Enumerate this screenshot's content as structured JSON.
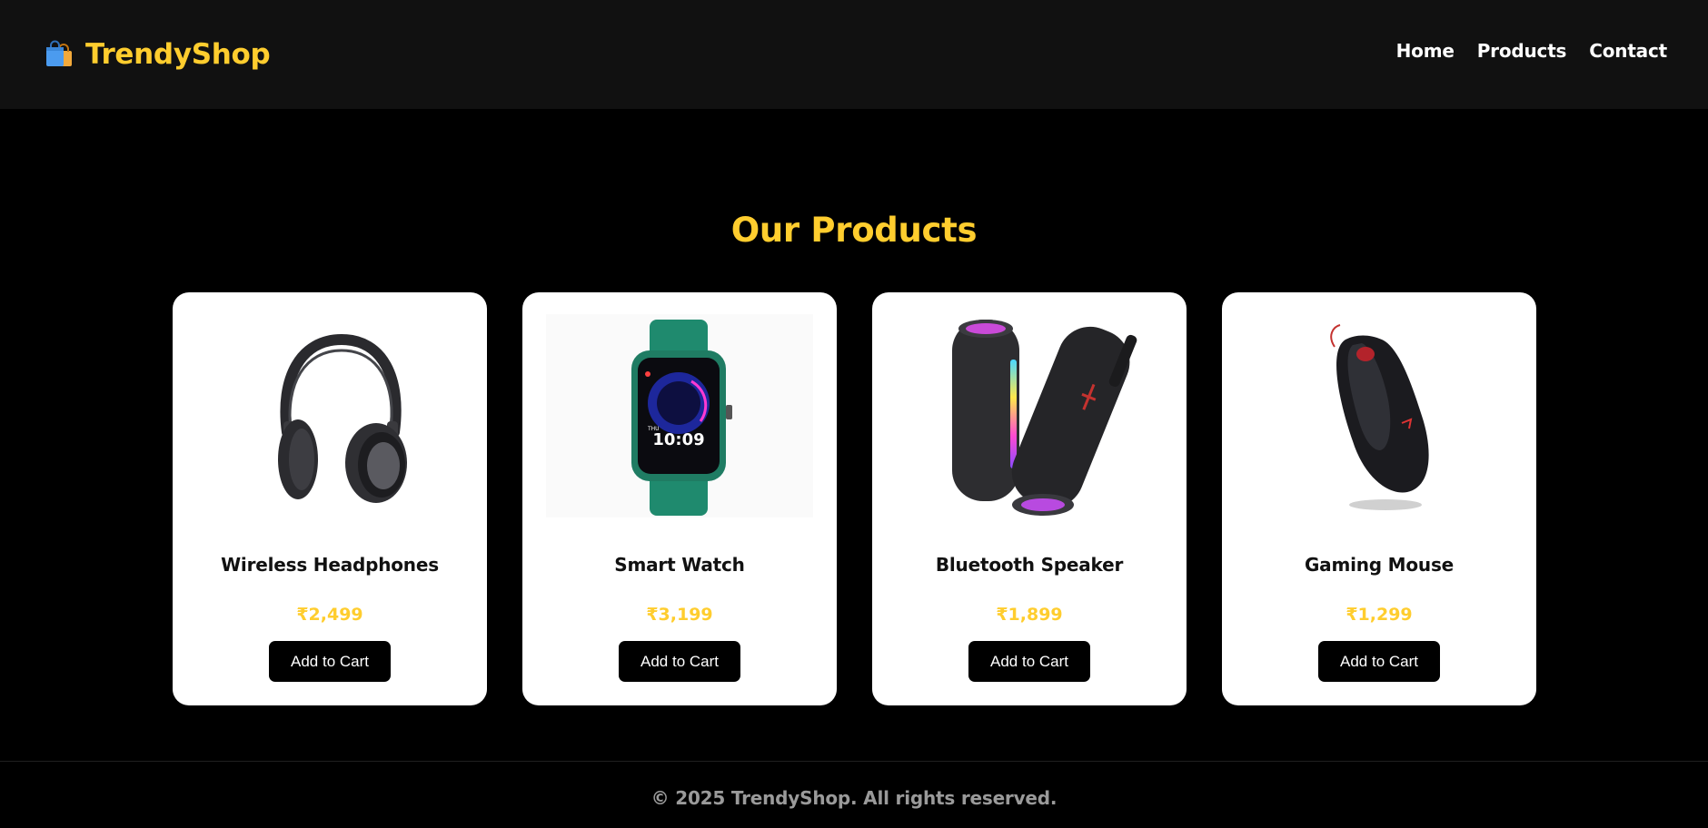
{
  "header": {
    "brand": "TrendyShop",
    "brand_icon": "shopping-bags-icon",
    "nav": [
      "Home",
      "Products",
      "Contact"
    ]
  },
  "main": {
    "title": "Our Products",
    "products": [
      {
        "name": "Wireless Headphones",
        "price": "₹2,499",
        "button": "Add to Cart",
        "image": "headphones-image"
      },
      {
        "name": "Smart Watch",
        "price": "₹3,199",
        "button": "Add to Cart",
        "image": "smartwatch-image"
      },
      {
        "name": "Bluetooth Speaker",
        "price": "₹1,899",
        "button": "Add to Cart",
        "image": "speakers-image"
      },
      {
        "name": "Gaming Mouse",
        "price": "₹1,299",
        "button": "Add to Cart",
        "image": "mouse-image"
      }
    ]
  },
  "footer": {
    "text": "© 2025 TrendyShop. All rights reserved."
  },
  "colors": {
    "header_bg": "#111111",
    "page_bg": "#000000",
    "accent": "#ffcd2e",
    "card_bg": "#ffffff",
    "button_bg": "#000000",
    "footer_text": "#9a9a9a"
  }
}
